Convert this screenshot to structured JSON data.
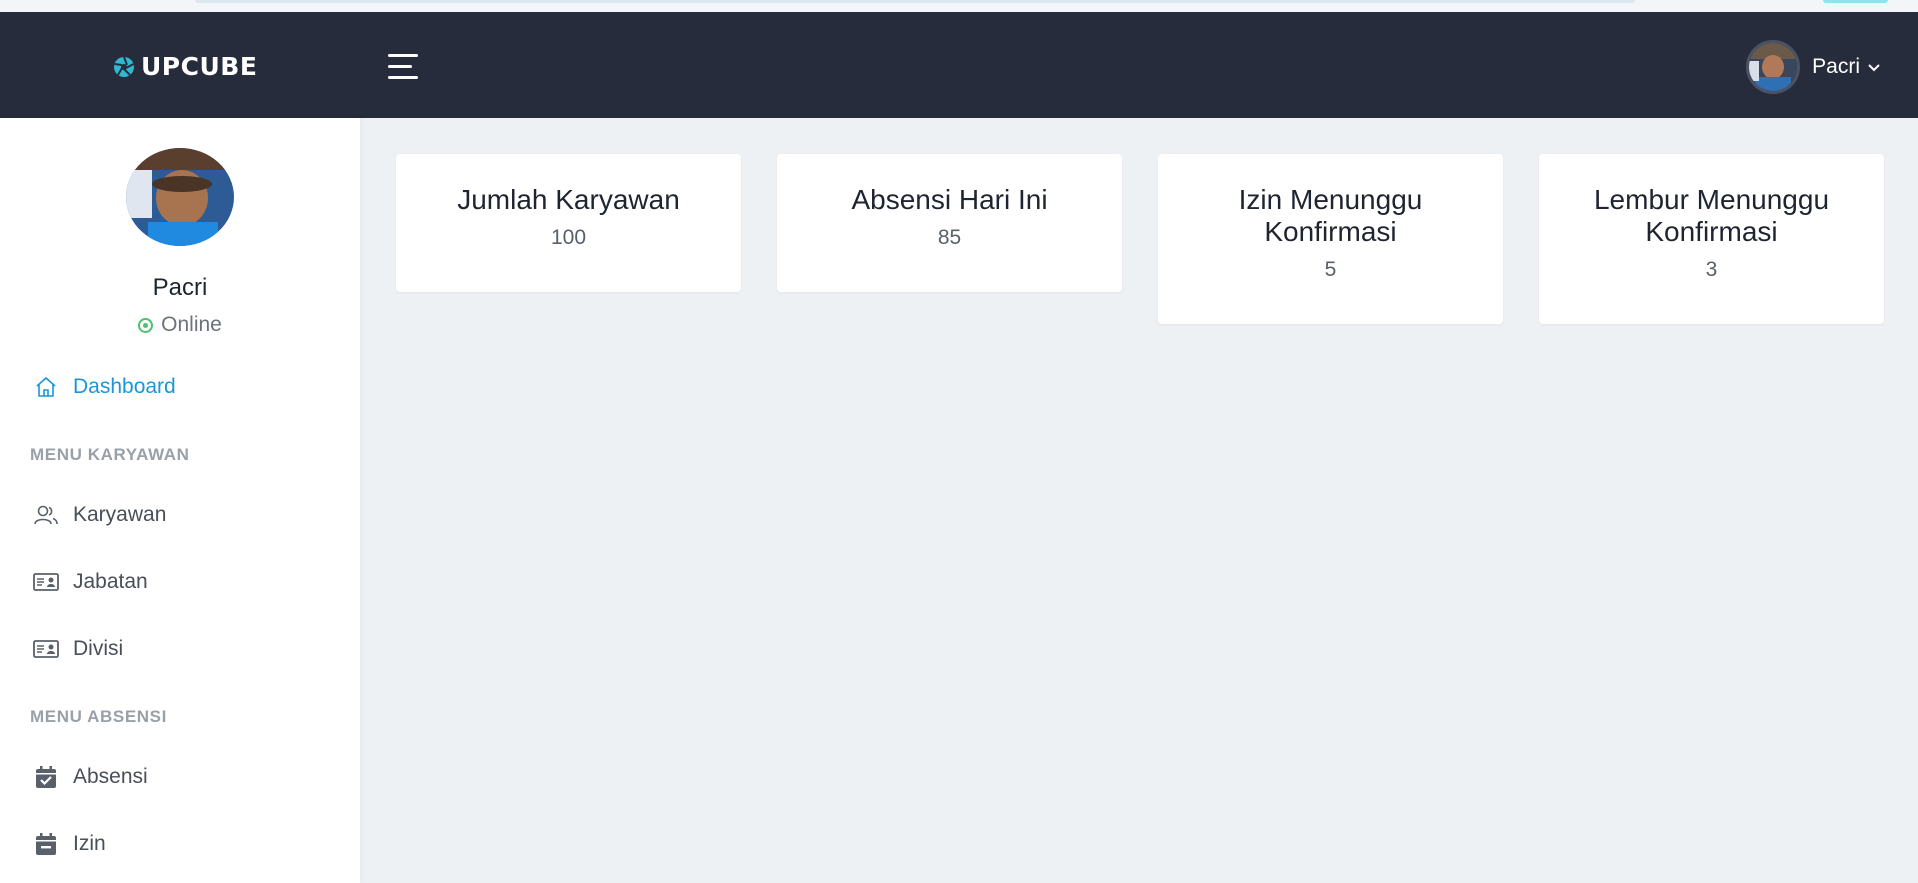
{
  "app": {
    "brand": "UPCUBE"
  },
  "header": {
    "menu_toggle": "menu-toggle",
    "user_name": "Pacri",
    "dropdown_caret": "⌄"
  },
  "profile": {
    "name": "Pacri",
    "status": "Online"
  },
  "sidebar": {
    "dashboard": "Dashboard",
    "section_karyawan": "MENU KARYAWAN",
    "karyawan": "Karyawan",
    "jabatan": "Jabatan",
    "divisi": "Divisi",
    "section_absensi": "MENU ABSENSI",
    "absensi": "Absensi",
    "izin": "Izin"
  },
  "cards": [
    {
      "title": "Jumlah Karyawan",
      "value": "100"
    },
    {
      "title": "Absensi Hari Ini",
      "value": "85"
    },
    {
      "title": "Izin Menunggu Konfirmasi",
      "value": "5"
    },
    {
      "title": "Lembur Menunggu Konfirmasi",
      "value": "3"
    }
  ],
  "colors": {
    "topbar": "#262c3b",
    "accent": "#1a96d9",
    "online": "#4cc26f",
    "logo_icon": "#2fb8d0"
  }
}
